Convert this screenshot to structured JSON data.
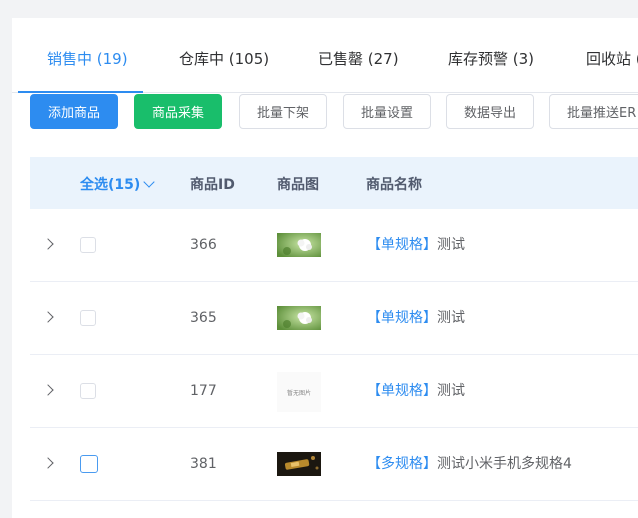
{
  "tabs": [
    {
      "label": "销售中 (19)"
    },
    {
      "label": "仓库中 (105)"
    },
    {
      "label": "已售罄 (27)"
    },
    {
      "label": "库存预警 (3)"
    },
    {
      "label": "回收站 ("
    }
  ],
  "toolbar": {
    "add": "添加商品",
    "collect": "商品采集",
    "batch_offshelf": "批量下架",
    "batch_settings": "批量设置",
    "export": "数据导出",
    "batch_push": "批量推送ER"
  },
  "table": {
    "select_all": "全选(15)",
    "col_id": "商品ID",
    "col_image": "商品图",
    "col_name": "商品名称"
  },
  "rows": [
    {
      "id": "366",
      "tag": "【单规格】",
      "title": "测试",
      "image": "white-flower"
    },
    {
      "id": "365",
      "tag": "【单规格】",
      "title": "测试",
      "image": "white-flower"
    },
    {
      "id": "177",
      "tag": "【单规格】",
      "title": "测试",
      "image": "placeholder",
      "placeholder_text": "暂无图片"
    },
    {
      "id": "381",
      "tag": "【多规格】",
      "title": "测试小米手机多规格4",
      "image": "dark-phone"
    }
  ],
  "colors": {
    "accent": "#2d8cf0",
    "success": "#19be6b",
    "header_bg": "#eaf3fc"
  }
}
